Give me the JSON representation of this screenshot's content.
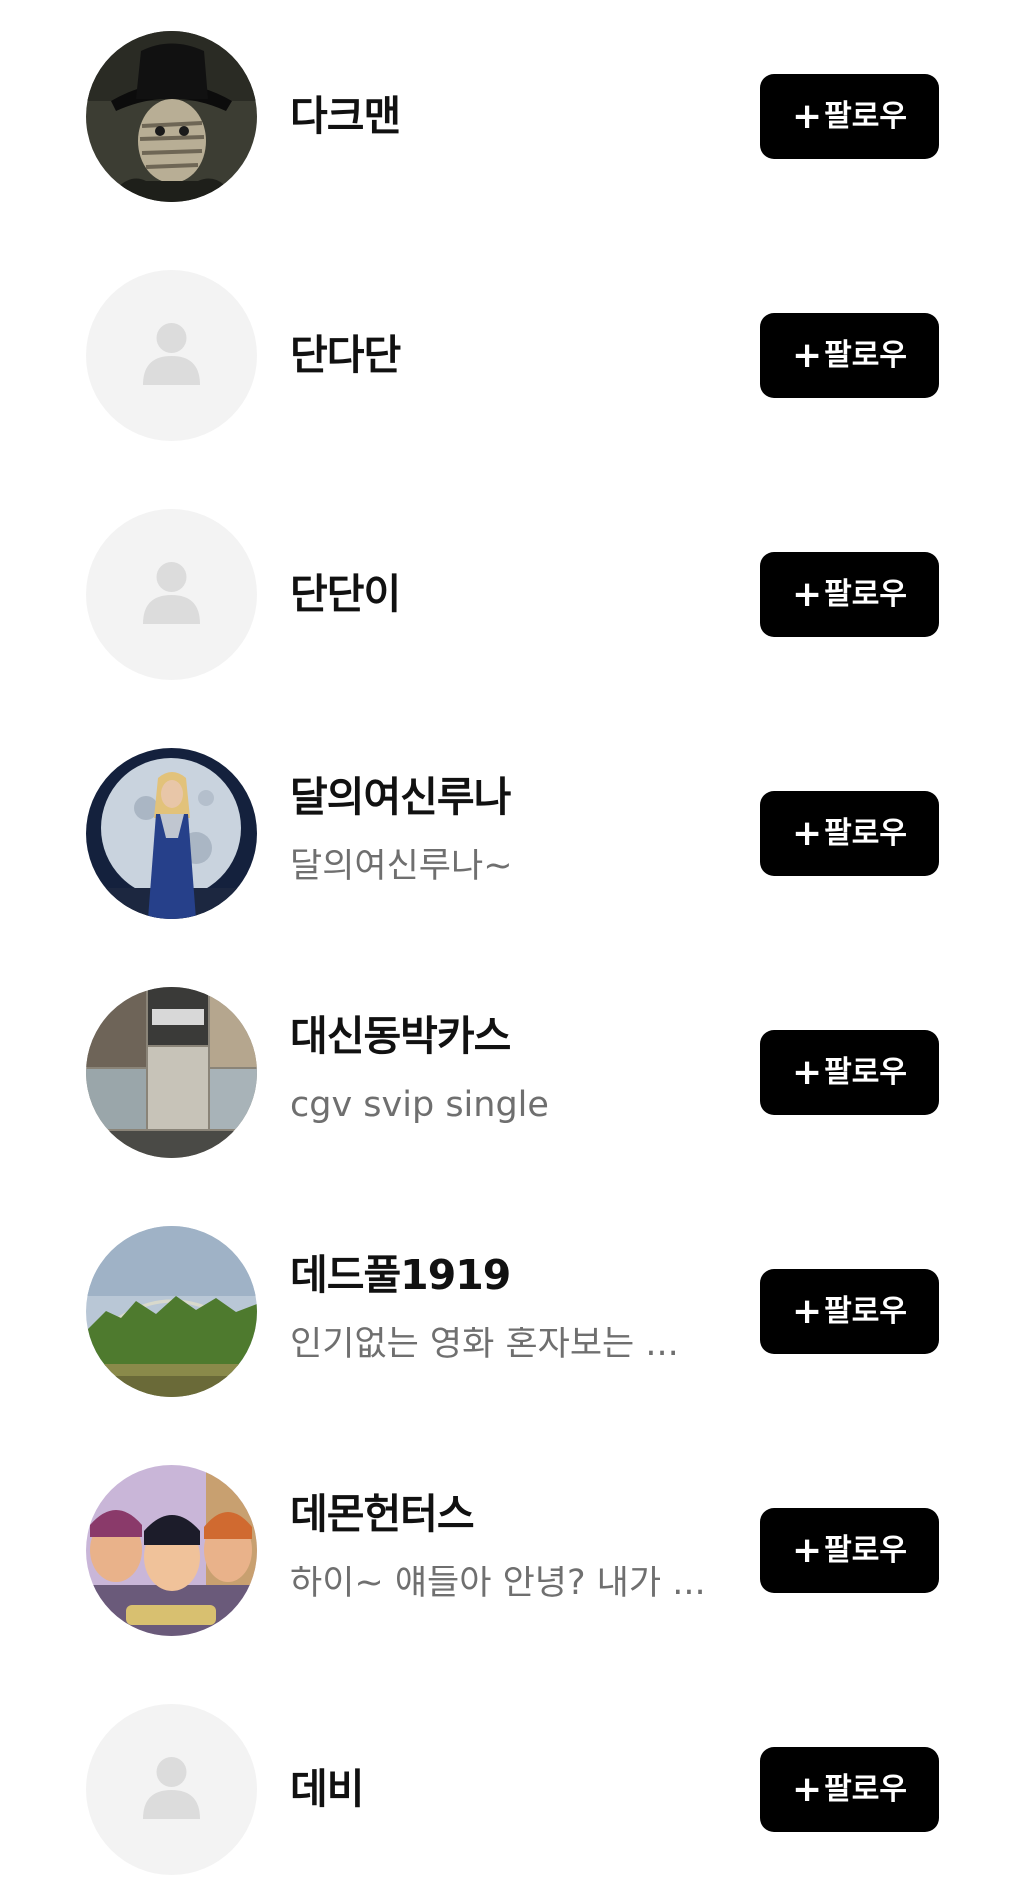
{
  "follow_label": "팔로우",
  "plus_glyph": "+",
  "users": [
    {
      "name": "다크맨",
      "bio": "",
      "avatar": "photo-masked-man"
    },
    {
      "name": "단다단",
      "bio": "",
      "avatar": "default-person-icon"
    },
    {
      "name": "단단이",
      "bio": "",
      "avatar": "default-person-icon"
    },
    {
      "name": "달의여신루나",
      "bio": "달의여신루나~",
      "avatar": "photo-moon-goddess"
    },
    {
      "name": "대신동박카스",
      "bio": "cgv svip single",
      "avatar": "photo-collage"
    },
    {
      "name": "데드풀1919",
      "bio": " 인기없는 영화 혼자보는 ...",
      "avatar": "photo-landscape-rainbow"
    },
    {
      "name": "데몬헌터스",
      "bio": "하이~ 얘들아 안녕? 내가 ...",
      "avatar": "photo-cartoon-characters"
    },
    {
      "name": "데비",
      "bio": "",
      "avatar": "default-person-icon"
    }
  ]
}
